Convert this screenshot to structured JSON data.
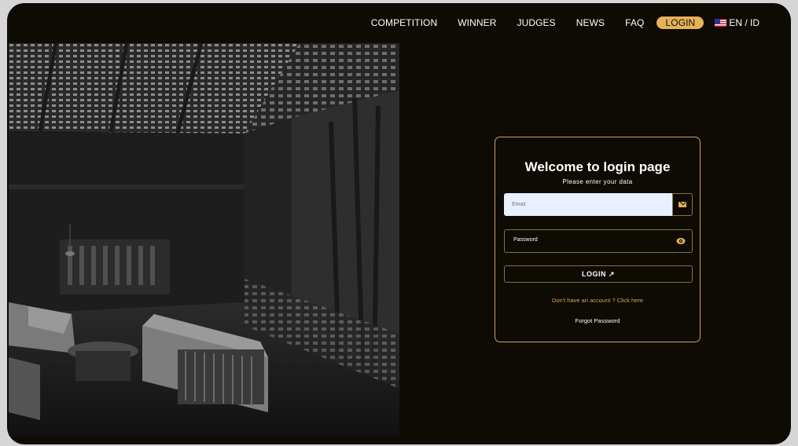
{
  "nav": {
    "items": [
      "COMPETITION",
      "WINNER",
      "JUDGES",
      "NEWS",
      "FAQ"
    ],
    "login_label": "LOGIN",
    "lang_label": "EN / ID"
  },
  "login": {
    "title": "Welcome to login page",
    "subtitle": "Please enter your data",
    "email_placeholder": "Email",
    "password_placeholder": "Password",
    "submit_label": "LOGIN ↗",
    "register_link": "Don't have an account ? Click here",
    "forgot_link": "Forgot Password"
  },
  "colors": {
    "background": "#0e0a04",
    "accent": "#e6b158",
    "card_border": "#c9a45e"
  },
  "icons": {
    "email_button": "envelope-icon",
    "password_toggle": "eye-icon",
    "flag": "us-flag-icon"
  }
}
